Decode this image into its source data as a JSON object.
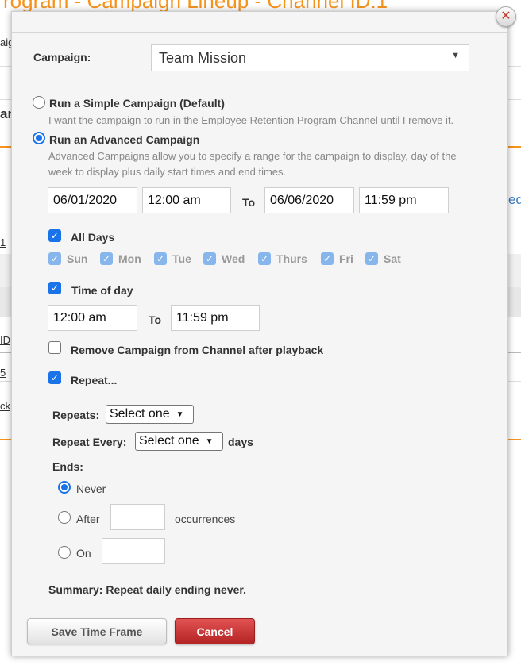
{
  "background": {
    "title": "rogram - Campaign Lineup - Channel ID:1",
    "fragments": [
      "aig",
      "ar",
      "ed",
      "1",
      "ID",
      "5",
      "ck"
    ]
  },
  "dialog": {
    "campaign_label": "Campaign:",
    "campaign_value": "Team Mission",
    "simple": {
      "label": "Run a Simple Campaign (Default)",
      "help": "I want the campaign to run in the Employee Retention Program Channel until I remove it."
    },
    "advanced": {
      "label": "Run an Advanced Campaign",
      "help_line1": "Advanced Campaigns allow you to specify a range for the campaign to display, day of the",
      "help_line2": "week to display plus daily start times and end times."
    },
    "range": {
      "start_date": "06/01/2020",
      "start_time": "12:00 am",
      "to_label": "To",
      "end_date": "06/06/2020",
      "end_time": "11:59 pm"
    },
    "all_days_label": "All Days",
    "days": [
      "Sun",
      "Mon",
      "Tue",
      "Wed",
      "Thurs",
      "Fri",
      "Sat"
    ],
    "time_of_day_label": "Time of day",
    "tod": {
      "start": "12:00 am",
      "to_label": "To",
      "end": "11:59 pm"
    },
    "remove_label": "Remove Campaign from Channel after playback",
    "repeat_label": "Repeat...",
    "repeats_label": "Repeats:",
    "repeats_value": "Select one",
    "repeat_every_label": "Repeat Every:",
    "repeat_every_value": "Select one",
    "days_unit": "days",
    "ends_label": "Ends:",
    "never_label": "Never",
    "after_label": "After",
    "occurrences_label": "occurrences",
    "on_label": "On",
    "summary": "Summary: Repeat daily ending never.",
    "save_label": "Save Time Frame",
    "cancel_label": "Cancel"
  },
  "colors": {
    "accent_orange": "#f7941d",
    "checkbox_blue": "#1a73e8",
    "cancel_red": "#c83232"
  }
}
